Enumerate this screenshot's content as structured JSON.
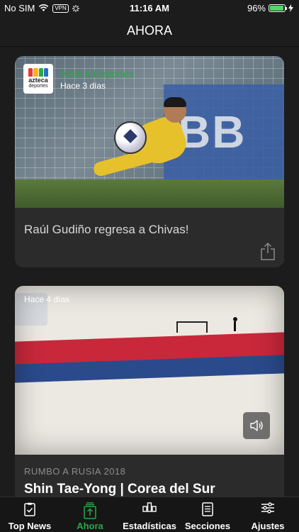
{
  "status_bar": {
    "carrier": "No SIM",
    "vpn": "VPN",
    "time": "11:16 AM",
    "battery": "96%",
    "battery_level": 0.96
  },
  "header": {
    "title": "AHORA"
  },
  "cards": [
    {
      "source": "Azteca Deportes",
      "logo_top": "azteca",
      "logo_bottom": "deportes",
      "time_ago": "Hace 3 días",
      "image_text": "BB",
      "title": "Raúl Gudiño regresa a Chivas!"
    },
    {
      "time_ago": "Hace 4 días",
      "kicker": "RUMBO A RUSIA 2018",
      "title": "Shin Tae-Yong  | Corea del Sur"
    }
  ],
  "tabs": [
    {
      "label": "Top News",
      "icon": "clipboard-check-icon"
    },
    {
      "label": "Ahora",
      "icon": "upload-stack-icon",
      "active": true
    },
    {
      "label": "Estadísticas",
      "icon": "bar-chart-icon"
    },
    {
      "label": "Secciones",
      "icon": "list-document-icon"
    },
    {
      "label": "Ajustes",
      "icon": "sliders-icon"
    }
  ],
  "colors": {
    "accent": "#2aa845",
    "background": "#1c1c1c",
    "card": "#2b2b2b"
  }
}
